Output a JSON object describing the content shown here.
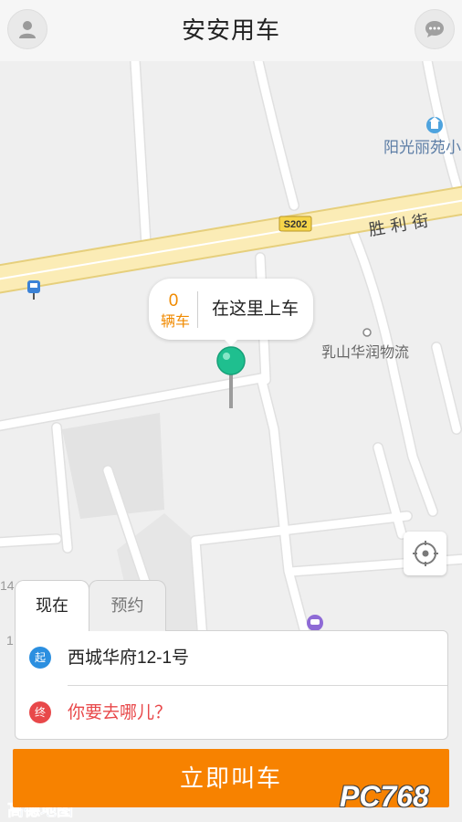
{
  "header": {
    "title": "安安用车",
    "left_icon": "user-icon",
    "right_icon": "chat-icon"
  },
  "map": {
    "poi_sunshine": "阳光丽苑小",
    "road_badge": "S202",
    "road_name": "胜利街",
    "poi_logistics": "乳山华润物流",
    "edge_label_1": "14",
    "edge_label_2": "1",
    "attribution": "高德地图",
    "icons": [
      "building-icon",
      "bus-stop-icon",
      "poi-dot-icon",
      "subway-icon",
      "pin-icon"
    ]
  },
  "popup": {
    "car_count": "0",
    "car_unit": "辆车",
    "action": "在这里上车"
  },
  "locate": {
    "icon": "locate-icon"
  },
  "tabs": [
    {
      "label": "现在",
      "active": true
    },
    {
      "label": "预约",
      "active": false
    }
  ],
  "trip": {
    "start_badge": "起",
    "start_address": "西城华府12-1号",
    "end_badge": "终",
    "end_placeholder": "你要去哪儿？"
  },
  "cta": {
    "label": "立即叫车"
  },
  "watermark": "PC768",
  "colors": {
    "accent": "#f78200",
    "start": "#2b8fe0",
    "end": "#e8484a",
    "pin": "#1fbf8f",
    "count": "#f08a00"
  }
}
